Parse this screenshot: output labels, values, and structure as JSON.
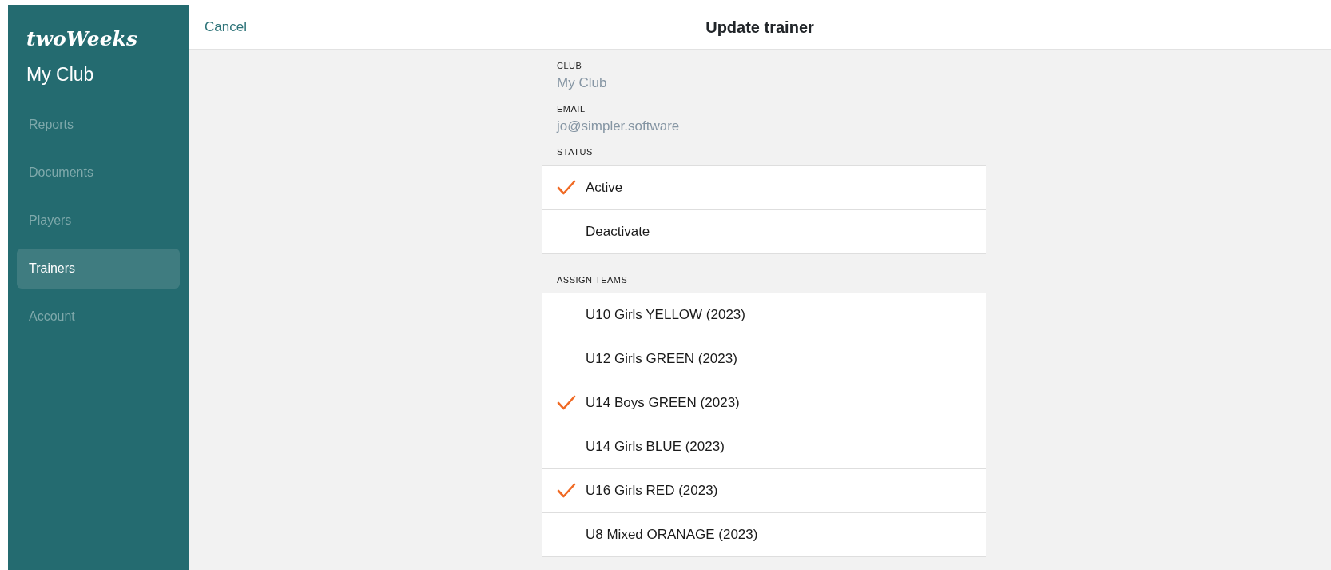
{
  "sidebar": {
    "logo": "twoWeeks",
    "club": "My Club",
    "items": [
      {
        "label": "Reports",
        "selected": false
      },
      {
        "label": "Documents",
        "selected": false
      },
      {
        "label": "Players",
        "selected": false
      },
      {
        "label": "Trainers",
        "selected": true
      },
      {
        "label": "Account",
        "selected": false
      }
    ]
  },
  "header": {
    "cancel": "Cancel",
    "title": "Update trainer"
  },
  "fields": [
    {
      "label": "CLUB",
      "value": "My Club"
    },
    {
      "label": "EMAIL",
      "value": "jo@simpler.software"
    }
  ],
  "status": {
    "label": "STATUS",
    "options": [
      {
        "label": "Active",
        "selected": true
      },
      {
        "label": "Deactivate",
        "selected": false
      }
    ]
  },
  "teams": {
    "label": "ASSIGN TEAMS",
    "items": [
      {
        "label": "U10 Girls YELLOW (2023)",
        "checked": false
      },
      {
        "label": "U12 Girls GREEN (2023)",
        "checked": false
      },
      {
        "label": "U14 Boys GREEN (2023)",
        "checked": true
      },
      {
        "label": "U14 Girls BLUE (2023)",
        "checked": false
      },
      {
        "label": "U16 Girls RED (2023)",
        "checked": true
      },
      {
        "label": "U8 Mixed ORANAGE (2023)",
        "checked": false
      }
    ]
  }
}
